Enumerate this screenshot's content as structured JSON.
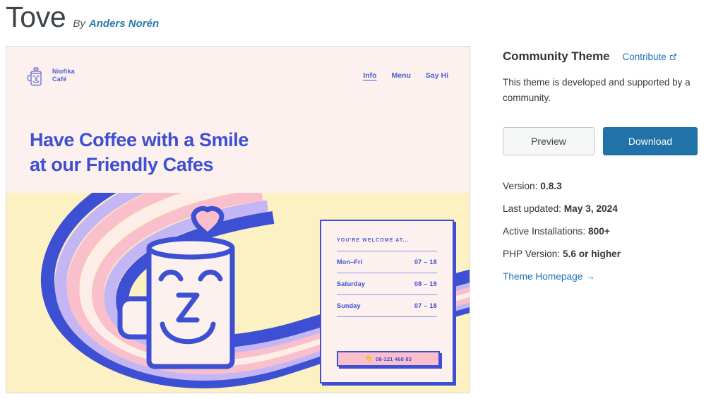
{
  "header": {
    "theme_name": "Tove",
    "by_label": "By",
    "author": "Anders Norén"
  },
  "preview": {
    "brand": {
      "line1": "Niofika",
      "line2": "Café",
      "logo_icon": "coffee-mug-heart-icon"
    },
    "nav": [
      {
        "label": "Info",
        "active": true
      },
      {
        "label": "Menu",
        "active": false
      },
      {
        "label": "Say Hi",
        "active": false
      }
    ],
    "headline_line1": "Have Coffee with a Smile",
    "headline_line2": "at our Friendly Cafes",
    "hours_card": {
      "label": "YOU'RE WELCOME AT...",
      "rows": [
        {
          "day": "Mon–Fri",
          "time": "07 – 18"
        },
        {
          "day": "Saturday",
          "time": "08 – 19"
        },
        {
          "day": "Sunday",
          "time": "07 – 18"
        }
      ],
      "phone_icon": "waving-hand-icon",
      "phone": "08-121 468 83"
    },
    "colors": {
      "cream": "#fcf1ee",
      "yellow": "#fbf1c2",
      "blue": "#3d4fd2",
      "lavender": "#c4b5f5",
      "pink": "#f9c0cb"
    }
  },
  "info": {
    "community_title": "Community Theme",
    "contribute_label": "Contribute",
    "contribute_icon": "external-link-icon",
    "description": "This theme is developed and supported by a community.",
    "preview_button": "Preview",
    "download_button": "Download",
    "meta": [
      {
        "label": "Version:",
        "value": "0.8.3"
      },
      {
        "label": "Last updated:",
        "value": "May 3, 2024"
      },
      {
        "label": "Active Installations:",
        "value": "800+"
      },
      {
        "label": "PHP Version:",
        "value": "5.6 or higher"
      }
    ],
    "homepage_link": "Theme Homepage  →",
    "accent_color": "#2271b1",
    "download_color": "#2172a8"
  }
}
